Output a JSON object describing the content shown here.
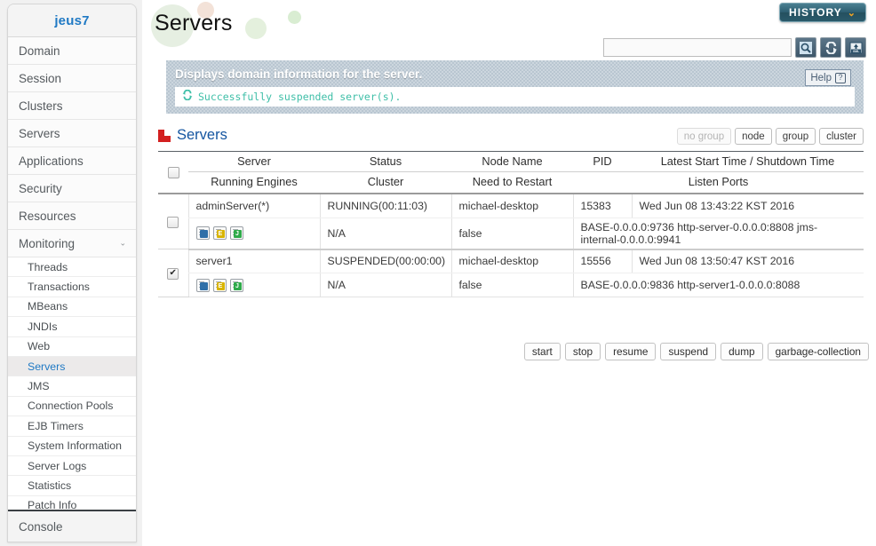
{
  "sidebar": {
    "brand": "jeus7",
    "top_items": [
      {
        "label": "Domain",
        "expandable": false
      },
      {
        "label": "Session",
        "expandable": false
      },
      {
        "label": "Clusters",
        "expandable": false
      },
      {
        "label": "Servers",
        "expandable": false
      },
      {
        "label": "Applications",
        "expandable": false
      },
      {
        "label": "Security",
        "expandable": false
      },
      {
        "label": "Resources",
        "expandable": false
      },
      {
        "label": "Monitoring",
        "expandable": true,
        "chevron": "⌄"
      }
    ],
    "sub_items": [
      {
        "label": "Threads",
        "active": false
      },
      {
        "label": "Transactions",
        "active": false
      },
      {
        "label": "MBeans",
        "active": false
      },
      {
        "label": "JNDIs",
        "active": false
      },
      {
        "label": "Web",
        "active": false
      },
      {
        "label": "Servers",
        "active": true
      },
      {
        "label": "JMS",
        "active": false
      },
      {
        "label": "Connection Pools",
        "active": false
      },
      {
        "label": "EJB Timers",
        "active": false
      },
      {
        "label": "System Information",
        "active": false
      },
      {
        "label": "Server Logs",
        "active": false
      },
      {
        "label": "Statistics",
        "active": false
      },
      {
        "label": "Patch Info",
        "active": false
      }
    ],
    "footer": "Console"
  },
  "header": {
    "page_title": "Servers",
    "history_label": "HISTORY",
    "history_chevron": "⌄"
  },
  "search": {
    "value": "",
    "placeholder": "",
    "icons": [
      "search-icon",
      "refresh-icon",
      "export-xml-icon"
    ]
  },
  "banner": {
    "title": "Displays domain information for the server.",
    "message": "Successfully suspended server(s).",
    "message_icon": "refresh-success-icon",
    "help_label": "Help",
    "help_mark": "?"
  },
  "section": {
    "title": "Servers",
    "group_buttons": [
      {
        "label": "no group",
        "disabled": true
      },
      {
        "label": "node",
        "disabled": false
      },
      {
        "label": "group",
        "disabled": false
      },
      {
        "label": "cluster",
        "disabled": false
      }
    ]
  },
  "table": {
    "headers_row1": [
      "Server",
      "Status",
      "Node Name",
      "PID",
      "Latest Start Time / Shutdown Time"
    ],
    "headers_row2": [
      "Running Engines",
      "Cluster",
      "Need to Restart",
      "Listen Ports"
    ],
    "select_all_checked": false,
    "rows": [
      {
        "checked": false,
        "server": "adminServer(*)",
        "status": "RUNNING(00:11:03)",
        "node_name": "michael-desktop",
        "pid": "15383",
        "latest_time": "Wed Jun 08 13:43:22 KST 2016",
        "engines": [
          {
            "name": "web-engine-icon",
            "letter": "",
            "kind": "web"
          },
          {
            "name": "ejb-engine-icon",
            "letter": "E",
            "kind": "ejb"
          },
          {
            "name": "jms-engine-icon",
            "letter": "J",
            "kind": "jms"
          }
        ],
        "cluster": "N/A",
        "need_to_restart": "false",
        "listen_ports": "BASE-0.0.0.0:9736 http-server-0.0.0.0:8808 jms-internal-0.0.0.0:9941"
      },
      {
        "checked": true,
        "server": "server1",
        "status": "SUSPENDED(00:00:00)",
        "node_name": "michael-desktop",
        "pid": "15556",
        "latest_time": "Wed Jun 08 13:50:47 KST 2016",
        "engines": [
          {
            "name": "web-engine-icon",
            "letter": "",
            "kind": "web"
          },
          {
            "name": "ejb-engine-icon",
            "letter": "E",
            "kind": "ejb"
          },
          {
            "name": "jms-engine-icon",
            "letter": "J",
            "kind": "jms"
          }
        ],
        "cluster": "N/A",
        "need_to_restart": "false",
        "listen_ports": "BASE-0.0.0.0:9836 http-server1-0.0.0.0:8088"
      }
    ]
  },
  "actions": [
    {
      "label": "start"
    },
    {
      "label": "stop"
    },
    {
      "label": "resume"
    },
    {
      "label": "suspend"
    },
    {
      "label": "dump"
    },
    {
      "label": "garbage-collection"
    }
  ],
  "colors": {
    "brand_blue": "#1f79c4",
    "section_blue": "#1455a0",
    "section_icon_red": "#d32020",
    "banner_bg": "#b9c6d1",
    "success_green": "#3fbfa8",
    "history_accent": "#f5a623"
  }
}
